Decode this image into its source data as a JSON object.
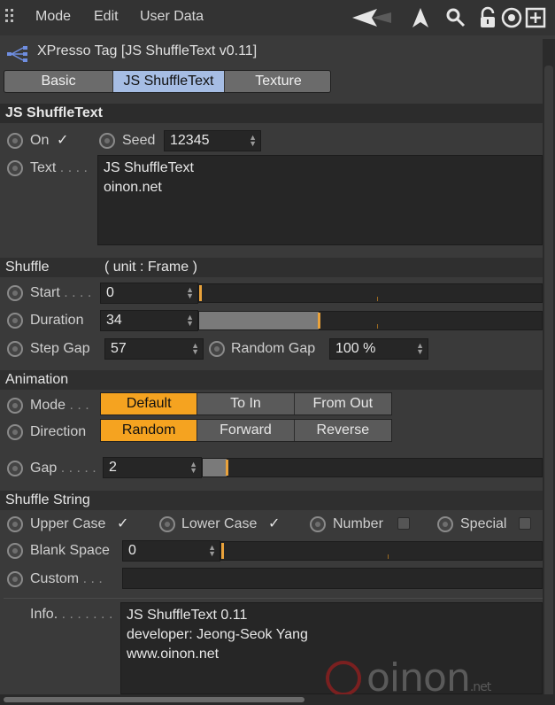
{
  "menubar": {
    "items": [
      "Mode",
      "Edit",
      "User Data"
    ],
    "icons": [
      "arrow-left-icon",
      "arrow-up-icon",
      "search-icon",
      "lock-icon",
      "target-icon",
      "new-panel-icon"
    ]
  },
  "title": "XPresso Tag [JS ShuffleText v0.11]",
  "tabs": [
    {
      "label": "Basic",
      "active": false
    },
    {
      "label": "JS ShuffleText",
      "active": true
    },
    {
      "label": "Texture",
      "active": false
    }
  ],
  "main_section": "JS ShuffleText",
  "general": {
    "on_label": "On",
    "seed_label": "Seed",
    "seed_value": "12345",
    "text_label": "Text",
    "text_dots": ". . . .",
    "text_lines": [
      "JS ShuffleText",
      "oinon.net"
    ]
  },
  "shuffle": {
    "header": "Shuffle",
    "unit": "( unit : Frame )",
    "start_label": "Start",
    "start_dots": ". . . .",
    "start_value": "0",
    "start_fraction": 0.0,
    "duration_label": "Duration",
    "duration_value": "34",
    "duration_fraction": 0.35,
    "stepgap_label": "Step Gap",
    "stepgap_value": "57",
    "randomgap_label": "Random Gap",
    "randomgap_value": "100 %"
  },
  "animation": {
    "header": "Animation",
    "mode_label": "Mode",
    "mode_dots": ". . .",
    "mode_options": [
      "Default",
      "To In",
      "From Out"
    ],
    "mode_selected": 0,
    "direction_label": "Direction",
    "direction_options": [
      "Random",
      "Forward",
      "Reverse"
    ],
    "direction_selected": 0
  },
  "gap": {
    "label": "Gap",
    "dots": ". . . . .",
    "value": "2",
    "fraction": 0.07
  },
  "shuffle_string": {
    "header": "Shuffle String",
    "upper_label": "Upper Case",
    "lower_label": "Lower Case",
    "number_label": "Number",
    "special_label": "Special",
    "checkmark": "✓",
    "blank_label": "Blank Space",
    "blank_value": "0",
    "custom_label": "Custom",
    "custom_dots": ". . .",
    "custom_value": ""
  },
  "info": {
    "label": "Info.",
    "dots": ". . . . . . .",
    "lines": [
      "JS ShuffleText 0.11",
      "developer: Jeong-Seok Yang",
      "www.oinon.net"
    ]
  },
  "watermark": {
    "text": "oinon",
    "suffix": ".net"
  },
  "colors": {
    "accent": "#f5a320",
    "tab_active": "#a6bde4",
    "panel": "#3a3a3a"
  }
}
